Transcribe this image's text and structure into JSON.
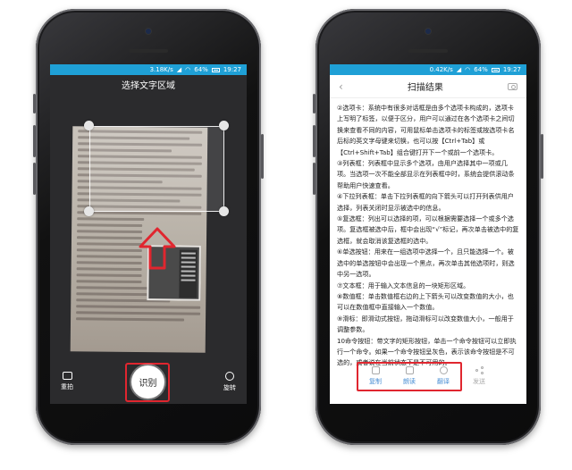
{
  "colors": {
    "status_bar": "#1fa0d6",
    "highlight": "#e0262f",
    "accent_blue": "#4a8fd4"
  },
  "left": {
    "status": {
      "speed": "3.18K/s",
      "battery": "64%",
      "time": "19:27"
    },
    "title": "选择文字区域",
    "retake_label": "重拍",
    "recognize_label": "识别",
    "rotate_label": "旋转"
  },
  "right": {
    "status": {
      "speed": "0.42K/s",
      "battery": "64%",
      "time": "19:27"
    },
    "title": "扫描结果",
    "paragraphs": [
      "②选项卡：系统中有很多对话框是由多个选项卡构成的，选项卡上写明了标签，以便于区分，用户可以通过在各个选项卡之间切换来查看不同的内容，可用鼠标单击选项卡的标签或按选项卡名后标的英文字母键来切换，也可以按【Ctrl+Tab】或【Ctrl+Shift+Tab】组合键打开下一个或前一个选项卡。",
      "③列表框：列表框中显示多个选项，由用户选择其中一项或几项。当选项一次不能全部显示在列表框中时，系统会提供滚动条帮助用户快速查看。",
      "④下拉列表框：单击下拉列表框的向下箭头可以打开列表供用户选择，列表关闭时显示被选中的信息。",
      "⑤复选框：列出可以选择的项，可以根据需要选择一个或多个选项。复选框被选中后，框中会出现“√”标记，再次单击被选中的复选框，就会取消该复选框的选中。",
      "⑥单选按钮：用来在一组选项中选择一个，且只能选择一个。被选中的单选按钮中会出现一个黑点，再次单击其他选项时，则选中另一选项。",
      "⑦文本框：用于输入文本信息的一块矩形区域。",
      "⑧数值框：单击数值框右边的上下箭头可以改变数值的大小，也可以在数值框中直接输入一个数值。",
      "⑨滑标：即滑动式按钮，拖动滑标可以改变数值大小，一般用于调整参数。",
      "10命令按钮：带文字的矩形按钮，单击一个命令按钮可以立即执行一个命令。如果一个命令按钮呈灰色，表示该命令按钮是不可选的，或者说在当前状态下是不可用的。"
    ],
    "actions": {
      "copy": "复制",
      "read": "朗读",
      "translate": "翻译",
      "send": "发送"
    }
  }
}
